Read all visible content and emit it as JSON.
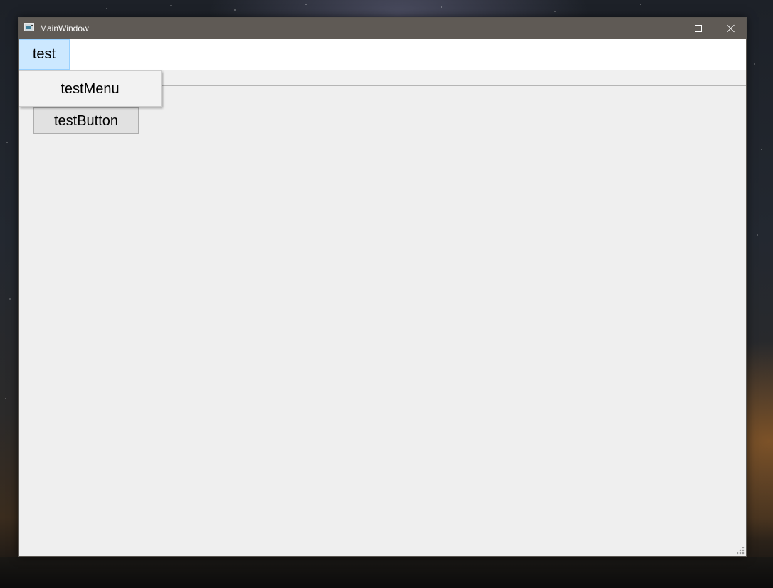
{
  "window": {
    "title": "MainWindow",
    "app_icon": "window-app-icon",
    "controls": {
      "minimize_icon": "minimize-icon",
      "maximize_icon": "maximize-icon",
      "close_icon": "close-icon"
    }
  },
  "menubar": {
    "items": [
      {
        "label": "test",
        "state": "open"
      }
    ]
  },
  "dropdown_menu": {
    "items": [
      {
        "label": "testMenu"
      }
    ]
  },
  "central": {
    "button_label": "testButton"
  },
  "colors": {
    "titlebar": "#5f5a55",
    "menu_highlight": "#cce8ff",
    "menu_highlight_border": "#99d1ff",
    "client_background": "#efefef",
    "button_face": "#e1e1e1"
  }
}
